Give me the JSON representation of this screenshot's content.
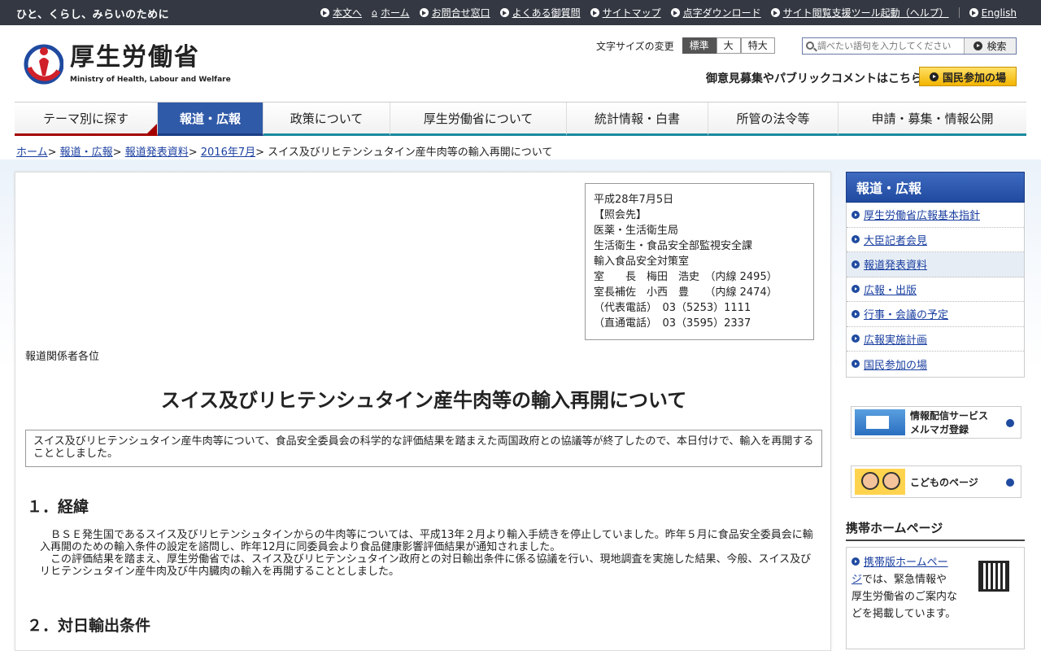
{
  "topbar": {
    "tagline": "ひと、くらし、みらいのために",
    "links": [
      "本文へ",
      "ホーム",
      "お問合せ窓口",
      "よくある御質問",
      "サイトマップ",
      "点字ダウンロード",
      "サイト閲覧支援ツール起動（ヘルプ）",
      "English"
    ]
  },
  "header": {
    "logo_jp": "厚生労働省",
    "logo_en": "Ministry of Health, Labour and Welfare",
    "fontsize_label": "文字サイズの変更",
    "fontsize_options": [
      "標準",
      "大",
      "特大"
    ],
    "search_placeholder": "調べたい語句を入力してください",
    "search_button": "検索",
    "opinion_text": "御意見募集やパブリックコメントはこちら",
    "kokumin_button": "国民参加の場"
  },
  "gnav": [
    "テーマ別に探す",
    "報道・広報",
    "政策について",
    "厚生労働省について",
    "統計情報・白書",
    "所管の法令等",
    "申請・募集・情報公開"
  ],
  "breadcrumb": {
    "links": [
      "ホーム",
      "報道・広報",
      "報道発表資料",
      "2016年7月"
    ],
    "current": "スイス及びリヒテンシュタイン産牛肉等の輸入再開について"
  },
  "contact": {
    "lines": [
      "平成28年7月5日",
      "【照会先】",
      "医薬・生活衛生局",
      "生活衛生・食品安全部監視安全課",
      "輸入食品安全対策室",
      "室　　長　梅田　浩史　（内線 2495）",
      "室長補佐　小西　豊　　（内線 2474）",
      "（代表電話）　03（5253）1111",
      "（直通電話）　03（3595）2337"
    ]
  },
  "main": {
    "addressee": "報道関係者各位",
    "title": "スイス及びリヒテンシュタイン産牛肉等の輸入再開について",
    "summary": "スイス及びリヒテンシュタイン産牛肉等について、食品安全委員会の科学的な評価結果を踏まえた両国政府との協議等が終了したので、本日付けで、輸入を再開することとしました。",
    "sec1_heading": "１．経緯",
    "sec1_p1": "　ＢＳＥ発生国であるスイス及びリヒテンシュタインからの牛肉等については、平成13年２月より輸入手続きを停止していました。昨年５月に食品安全委員会に輸入再開のための輸入条件の設定を諮問し、昨年12月に同委員会より食品健康影響評価結果が通知されました。",
    "sec1_p2": "　この評価結果を踏まえ、厚生労働省では、スイス及びリヒテンシュタイン政府との対日輸出条件に係る協議を行い、現地調査を実施した結果、今般、スイス及びリヒテンシュタイン産牛肉及び牛内臓肉の輸入を再開することとしました。",
    "sec2_heading": "２．対日輸出条件"
  },
  "sidebar": {
    "heading": "報道・広報",
    "items": [
      "厚生労働省広報基本指針",
      "大臣記者会見",
      "報道発表資料",
      "広報・出版",
      "行事・会議の予定",
      "広報実施計画",
      "国民参加の場"
    ],
    "mail_banner_line1": "情報配信サービス",
    "mail_banner_line2": "メルマガ登録",
    "kids_banner": "こどものページ",
    "mobile_heading": "携帯ホームページ",
    "mobile_link": "携帯版ホームページ",
    "mobile_text": "では、緊急情報や厚生労働省のご案内などを掲載しています。"
  },
  "colors": {
    "nav_active": "#2f5aa8",
    "topbar": "#333842",
    "link": "#1a3fa0",
    "accent_yellow": "#f2b400"
  }
}
